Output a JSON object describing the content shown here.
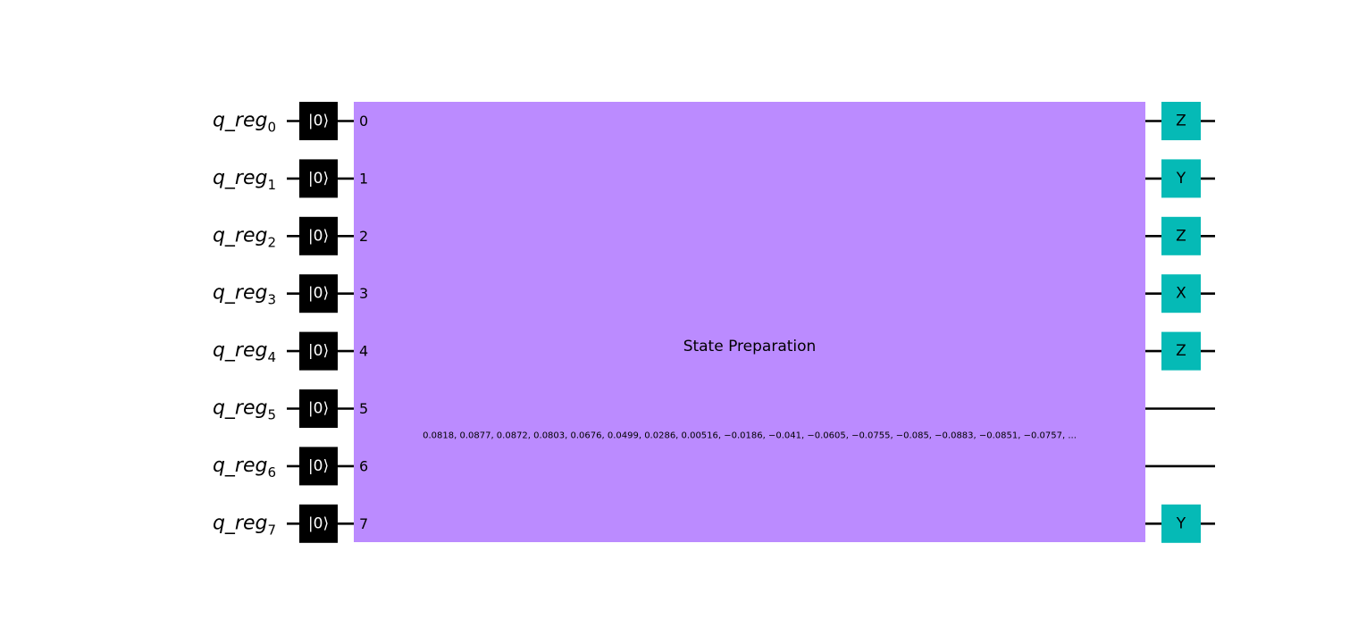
{
  "circuit": {
    "qubits": [
      {
        "name": "q_reg",
        "index": "0"
      },
      {
        "name": "q_reg",
        "index": "1"
      },
      {
        "name": "q_reg",
        "index": "2"
      },
      {
        "name": "q_reg",
        "index": "3"
      },
      {
        "name": "q_reg",
        "index": "4"
      },
      {
        "name": "q_reg",
        "index": "5"
      },
      {
        "name": "q_reg",
        "index": "6"
      },
      {
        "name": "q_reg",
        "index": "7"
      }
    ],
    "reset_label": "|0⟩",
    "state_preparation": {
      "label": "State Preparation",
      "params": "0.0818, 0.0877, 0.0872, 0.0803, 0.0676, 0.0499, 0.0286, 0.00516, −0.0186, −0.041, −0.0605, −0.0755, −0.085, −0.0883, −0.0851, −0.0757, ...",
      "port_labels": [
        "0",
        "1",
        "2",
        "3",
        "4",
        "5",
        "6",
        "7"
      ]
    },
    "paulis": [
      {
        "qubit": 0,
        "label": "Z"
      },
      {
        "qubit": 1,
        "label": "Y"
      },
      {
        "qubit": 2,
        "label": "Z"
      },
      {
        "qubit": 3,
        "label": "X"
      },
      {
        "qubit": 4,
        "label": "Z"
      },
      {
        "qubit": 7,
        "label": "Y"
      }
    ],
    "colors": {
      "reset": "#000000",
      "state_preparation": "#bb8bff",
      "pauli": "#05bab6",
      "wire": "#000000"
    }
  }
}
